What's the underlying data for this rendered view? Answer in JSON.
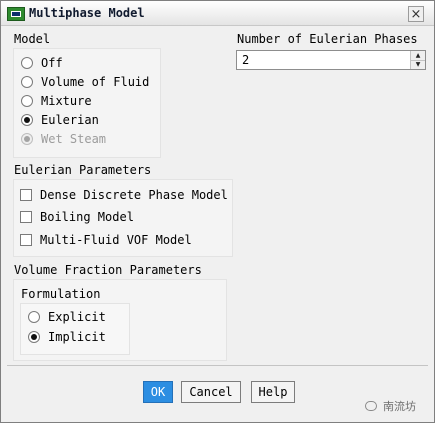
{
  "window": {
    "title": "Multiphase Model"
  },
  "model": {
    "heading": "Model",
    "options": [
      {
        "label": "Off",
        "selected": false,
        "enabled": true
      },
      {
        "label": "Volume of Fluid",
        "selected": false,
        "enabled": true
      },
      {
        "label": "Mixture",
        "selected": false,
        "enabled": true
      },
      {
        "label": "Eulerian",
        "selected": true,
        "enabled": true
      },
      {
        "label": "Wet Steam",
        "selected": false,
        "enabled": false
      }
    ]
  },
  "phases": {
    "label": "Number of Eulerian Phases",
    "value": "2"
  },
  "eulerian": {
    "heading": "Eulerian Parameters",
    "options": [
      {
        "label": "Dense Discrete Phase Model",
        "checked": false
      },
      {
        "label": "Boiling Model",
        "checked": false
      },
      {
        "label": "Multi-Fluid VOF Model",
        "checked": false
      }
    ]
  },
  "volume_fraction": {
    "heading": "Volume Fraction Parameters",
    "formulation": {
      "heading": "Formulation",
      "options": [
        {
          "label": "Explicit",
          "selected": false
        },
        {
          "label": "Implicit",
          "selected": true
        }
      ]
    }
  },
  "buttons": {
    "ok": "OK",
    "cancel": "Cancel",
    "help": "Help"
  },
  "watermark": "南流坊"
}
